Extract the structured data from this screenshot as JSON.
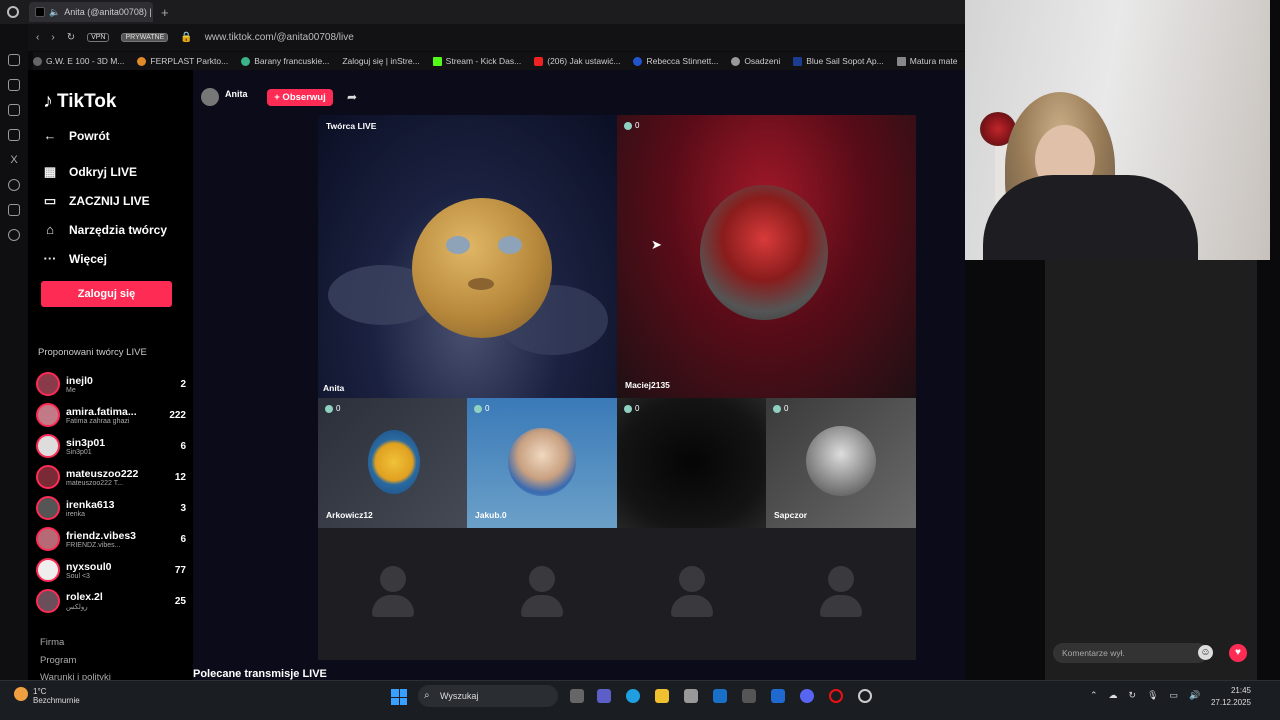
{
  "browser": {
    "tab_title": "Anita (@anita00708) |",
    "new_tab_icon": "+",
    "vpn_badge": "VPN",
    "private_badge": "PRYWATNE",
    "url": "www.tiktok.com/@anita00708/live"
  },
  "bookmarks": [
    "G.W. E 100 - 3D M...",
    "FERPLAST Parkto...",
    "Barany francuskie...",
    "Zaloguj się | inStre...",
    "Stream - Kick Das...",
    "(206) Jak ustawić...",
    "Rebecca Stinnett...",
    "Osadzeni",
    "Blue Sail Sopot Ap...",
    "Matura mate"
  ],
  "sidebar": {
    "logo": "TikTok",
    "back": "Powrót",
    "nav": [
      "Odkryj LIVE",
      "ZACZNIJ LIVE",
      "Narzędzia twórcy",
      "Więcej"
    ],
    "login_button": "Zaloguj się",
    "suggested_title": "Proponowani twórcy LIVE",
    "suggested": [
      {
        "name": "inejl0",
        "sub": "Me",
        "count": "2"
      },
      {
        "name": "amira.fatima...",
        "sub": "Fatima zahraa ghazi",
        "count": "222"
      },
      {
        "name": "sin3p01",
        "sub": "Sin3p01",
        "count": "6"
      },
      {
        "name": "mateuszoo222",
        "sub": "mateuszoo222 T...",
        "count": "12"
      },
      {
        "name": "irenka613",
        "sub": "irenka",
        "count": "3"
      },
      {
        "name": "friendz.vibes3",
        "sub": "FRIENDZ.vibes...",
        "count": "6"
      },
      {
        "name": "nyxsoul0",
        "sub": "Soul <3",
        "count": "77"
      },
      {
        "name": "rolex.2l",
        "sub": "رولكس",
        "count": "25"
      }
    ],
    "footer": [
      "Firma",
      "Program",
      "Warunki i polityki"
    ]
  },
  "live": {
    "host_name": "Anita",
    "follow_button": "+ Obserwuj",
    "creator_label": "Twórca LIVE",
    "host_tile_name": "Anita",
    "guests": [
      {
        "name": "Maciej2135",
        "viewers": "0"
      },
      {
        "name": "Arkowicz12",
        "viewers": "0"
      },
      {
        "name": "Jakub.0",
        "viewers": "0"
      },
      {
        "name": "",
        "viewers": "0"
      },
      {
        "name": "Sapczor",
        "viewers": "0"
      }
    ],
    "recommended": "Polecane transmisje LIVE"
  },
  "chat": {
    "placeholder": "Komentarze wył."
  },
  "taskbar": {
    "weather_temp": "1°C",
    "weather_text": "Bezchmurnie",
    "search": "Wyszukaj",
    "time": "21:45",
    "date": "27.12.2025"
  },
  "colors": {
    "accent": "#fe2c55",
    "sidebar_bg": "#000000",
    "main_bg": "#0b0b1a"
  }
}
